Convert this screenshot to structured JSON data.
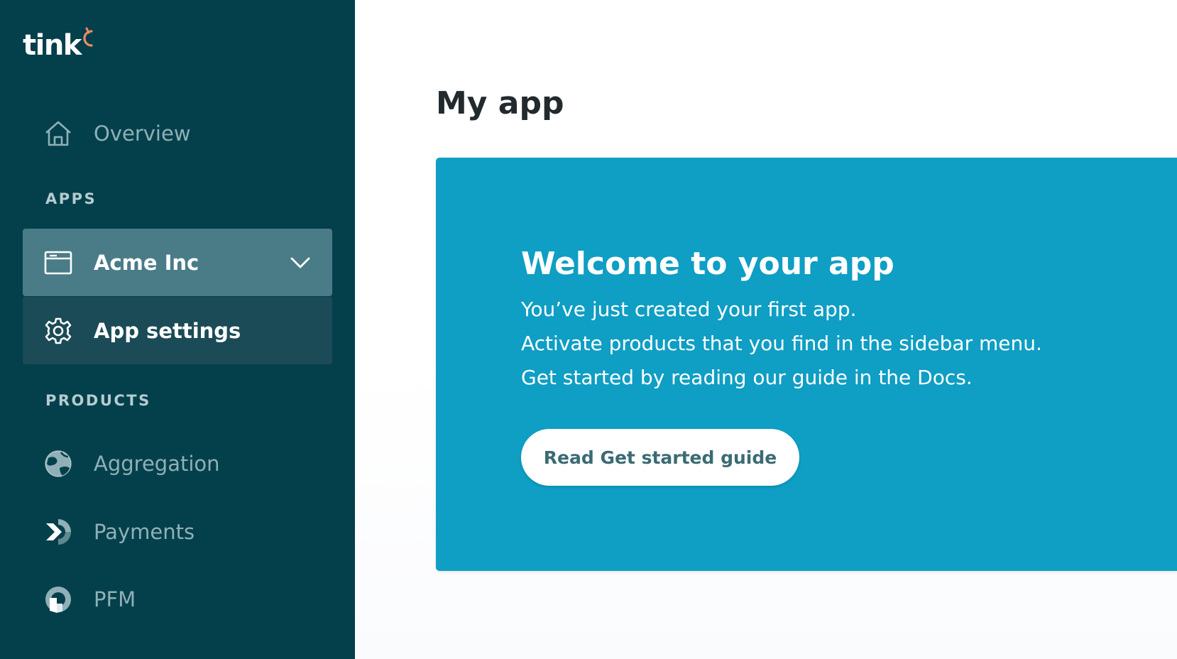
{
  "brand": {
    "name": "tink",
    "accent_color": "#f08a64"
  },
  "sidebar": {
    "background": "#04404c",
    "overview": {
      "label": "Overview",
      "icon": "home-icon"
    },
    "apps_heading": "APPS",
    "app_selector": {
      "label": "Acme Inc",
      "icon": "window-icon",
      "expanded": true
    },
    "app_settings": {
      "label": "App settings",
      "icon": "gear-icon"
    },
    "products_heading": "PRODUCTS",
    "products": [
      {
        "label": "Aggregation",
        "icon": "globe-icon"
      },
      {
        "label": "Payments",
        "icon": "payments-arrow-icon"
      },
      {
        "label": "PFM",
        "icon": "pfm-icon"
      }
    ]
  },
  "main": {
    "title": "My app",
    "card": {
      "background": "#0f9ec4",
      "title": "Welcome to your app",
      "lines": [
        "You’ve just created your first app.",
        "Activate products that you find in the sidebar menu.",
        "Get started by reading our guide in the Docs."
      ],
      "button_label": "Read Get started guide"
    }
  }
}
